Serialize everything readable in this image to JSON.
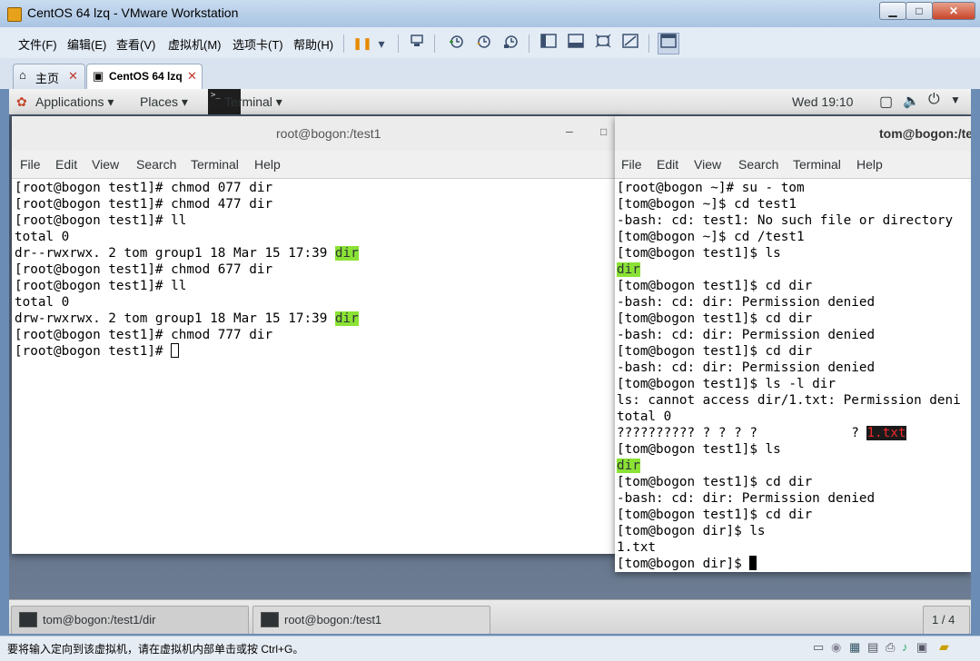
{
  "window": {
    "title": "CentOS 64 lzq - VMware Workstation",
    "min": "▁",
    "max": "□",
    "close": "✕"
  },
  "menu": [
    "文件(F)",
    "编辑(E)",
    "查看(V)",
    "虚拟机(M)",
    "选项卡(T)",
    "帮助(H)"
  ],
  "toolbar": {
    "pause": "❚❚",
    "dropdown": "▾"
  },
  "tabs": {
    "home": "主页",
    "vm": "CentOS 64 lzq",
    "close": "✕"
  },
  "gnome": {
    "applications": "Applications ▾",
    "places": "Places ▾",
    "terminal": "Terminal ▾",
    "clock": "Wed 19:10"
  },
  "term_left": {
    "title": "root@bogon:/test1",
    "menu": [
      "File",
      "Edit",
      "View",
      "Search",
      "Terminal",
      "Help"
    ],
    "lines": [
      {
        "text": "[root@bogon test1]# chmod 077 dir"
      },
      {
        "text": "[root@bogon test1]# chmod 477 dir"
      },
      {
        "text": "[root@bogon test1]# ll"
      },
      {
        "text": "total 0"
      },
      {
        "text": "dr--rwxrwx. 2 tom group1 18 Mar 15 17:39 ",
        "hl": "dir",
        "hlclass": "hl-green"
      },
      {
        "text": "[root@bogon test1]# chmod 677 dir"
      },
      {
        "text": "[root@bogon test1]# ll"
      },
      {
        "text": "total 0"
      },
      {
        "text": "drw-rwxrwx. 2 tom group1 18 Mar 15 17:39 ",
        "hl": "dir",
        "hlclass": "hl-green"
      },
      {
        "text": "[root@bogon test1]# chmod 777 dir"
      },
      {
        "text": "[root@bogon test1]# ",
        "cursor": "box"
      }
    ]
  },
  "term_right": {
    "title": "tom@bogon:/te",
    "menu": [
      "File",
      "Edit",
      "View",
      "Search",
      "Terminal",
      "Help"
    ],
    "lines": [
      {
        "text": "[root@bogon ~]# su - tom"
      },
      {
        "text": "[tom@bogon ~]$ cd test1"
      },
      {
        "text": "-bash: cd: test1: No such file or directory"
      },
      {
        "text": "[tom@bogon ~]$ cd /test1"
      },
      {
        "text": "[tom@bogon test1]$ ls"
      },
      {
        "text": "",
        "hl": "dir",
        "hlclass": "hl-green"
      },
      {
        "text": "[tom@bogon test1]$ cd dir"
      },
      {
        "text": "-bash: cd: dir: Permission denied"
      },
      {
        "text": "[tom@bogon test1]$ cd dir"
      },
      {
        "text": "-bash: cd: dir: Permission denied"
      },
      {
        "text": "[tom@bogon test1]$ cd dir"
      },
      {
        "text": "-bash: cd: dir: Permission denied"
      },
      {
        "text": "[tom@bogon test1]$ ls -l dir"
      },
      {
        "text": "ls: cannot access dir/1.txt: Permission deni"
      },
      {
        "text": "total 0"
      },
      {
        "text": "?????????? ? ? ? ?            ? ",
        "hl": "1.txt",
        "hlclass": "hl-red"
      },
      {
        "text": "[tom@bogon test1]$ ls"
      },
      {
        "text": "",
        "hl": "dir",
        "hlclass": "hl-green"
      },
      {
        "text": "[tom@bogon test1]$ cd dir"
      },
      {
        "text": "-bash: cd: dir: Permission denied"
      },
      {
        "text": "[tom@bogon test1]$ cd dir"
      },
      {
        "text": "[tom@bogon dir]$ ls"
      },
      {
        "text": "1.txt"
      },
      {
        "text": "[tom@bogon dir]$ ",
        "cursor": "solid"
      }
    ]
  },
  "taskbar": {
    "items": [
      "tom@bogon:/test1/dir",
      "root@bogon:/test1"
    ],
    "workspace": "1 / 4"
  },
  "status": {
    "text": "要将输入定向到该虚拟机，请在虚拟机内部单击或按 Ctrl+G。"
  }
}
